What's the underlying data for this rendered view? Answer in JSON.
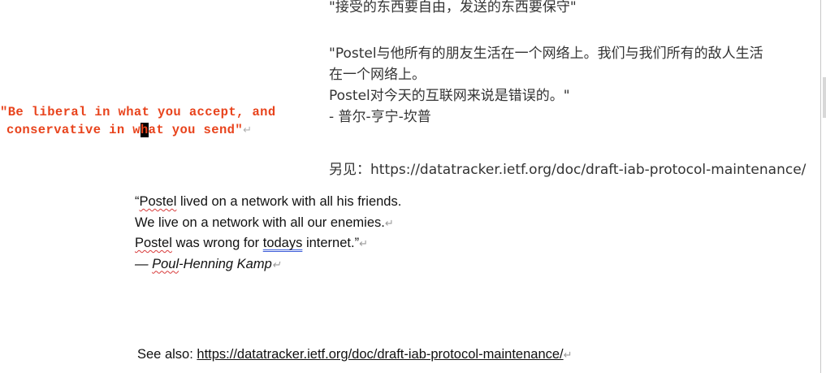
{
  "red_quote": {
    "line1": "\"Be liberal in what you accept, and",
    "line2_before_cursor": "conservative in w",
    "line2_cursor_char": "h",
    "line2_after_cursor": "at you send\"",
    "color": "#e8431c"
  },
  "chinese": {
    "line_motto": "\"接受的东西要自由，发送的东西要保守\"",
    "para1_line1": "\"Postel与他所有的朋友生活在一个网络上。我们与我们所有的敌人生活",
    "para1_line2": "在一个网络上。",
    "para1_line3": "Postel对今天的互联网来说是错误的。\"",
    "para1_line4": "- 普尔-亨宁-坎普",
    "see_also": "另见：https://datatracker.ietf.org/doc/draft-iab-protocol-maintenance/"
  },
  "english": {
    "line1_open": "“",
    "line1_postel": "Postel",
    "line1_rest": " lived on a network with all his friends.",
    "line2": "We live on a network with all our enemies.",
    "line3_postel": "Postel",
    "line3_mid": " was wrong for ",
    "line3_todays": "todays",
    "line3_end": " internet.”",
    "line4_dash": "— ",
    "line4_poul": "Poul",
    "line4_rest": "-Henning Kamp",
    "see_also_label": "See also: ",
    "see_also_link": "https://datatracker.ietf.org/doc/draft-iab-protocol-maintenance/"
  },
  "paragraph_mark": "↵"
}
